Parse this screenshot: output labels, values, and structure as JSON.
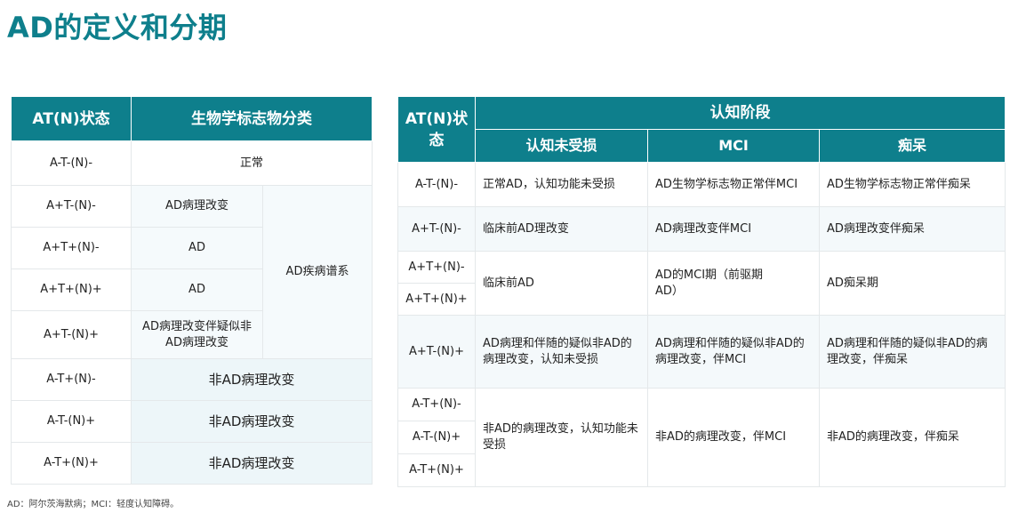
{
  "title": "AD的定义和分期",
  "left_table": {
    "headers": [
      "AT(N)状态",
      "生物学标志物分类"
    ],
    "rows": [
      {
        "status": "A-T-(N)-",
        "class": "正常"
      },
      {
        "status": "A+T-(N)-",
        "class": "AD病理改变"
      },
      {
        "status": "A+T+(N)-",
        "class": "AD"
      },
      {
        "status": "A+T+(N)+",
        "class": "AD"
      },
      {
        "status": "A+T-(N)+",
        "class": "AD病理改变伴疑似非AD病理改变"
      },
      {
        "status": "A-T+(N)-",
        "class": "非AD病理改变"
      },
      {
        "status": "A-T-(N)+",
        "class": "非AD病理改变"
      },
      {
        "status": "A-T+(N)+",
        "class": "非AD病理改变"
      }
    ],
    "spectrum": "AD疾病谱系"
  },
  "right_table": {
    "header_status": "AT(N)状态",
    "header_group": "认知阶段",
    "subheaders": [
      "认知未受损",
      "MCI",
      "痴呆"
    ],
    "rows": {
      "r1": {
        "status": "A-T-(N)-",
        "c1": "正常AD，认知功能未受损",
        "c2": "AD生物学标志物正常伴MCI",
        "c3": "AD生物学标志物正常伴痴呆"
      },
      "r2": {
        "status": "A+T-(N)-",
        "c1": "临床前AD理改变",
        "c2": "AD病理改变伴MCI",
        "c3": "AD病理改变伴痴呆"
      },
      "r3": {
        "status1": "A+T+(N)-",
        "status2": "A+T+(N)+",
        "c1": "临床前AD",
        "c2": "AD的MCI期（前驱期AD）",
        "c3": "AD痴呆期"
      },
      "r4": {
        "status": "A+T-(N)+",
        "c1": "AD病理和伴随的疑似非AD的病理改变，认知未受损",
        "c2": "AD病理和伴随的疑似非AD的病理改变，伴MCI",
        "c3": "AD病理和伴随的疑似非AD的病理改变，伴痴呆"
      },
      "r5": {
        "status1": "A-T+(N)-",
        "status2": "A-T-(N)+",
        "status3": "A-T+(N)+",
        "c1": "非AD的病理改变，认知功能未受损",
        "c2": "非AD的病理改变，伴MCI",
        "c3": "非AD的病理改变，伴痴呆"
      }
    }
  },
  "footnote": "AD：阿尔茨海默病；MCI：轻度认知障碍。",
  "colors": {
    "accent": "#0e7f8c",
    "header_text": "#ffffff",
    "row_tint": "#f4f9fb"
  }
}
